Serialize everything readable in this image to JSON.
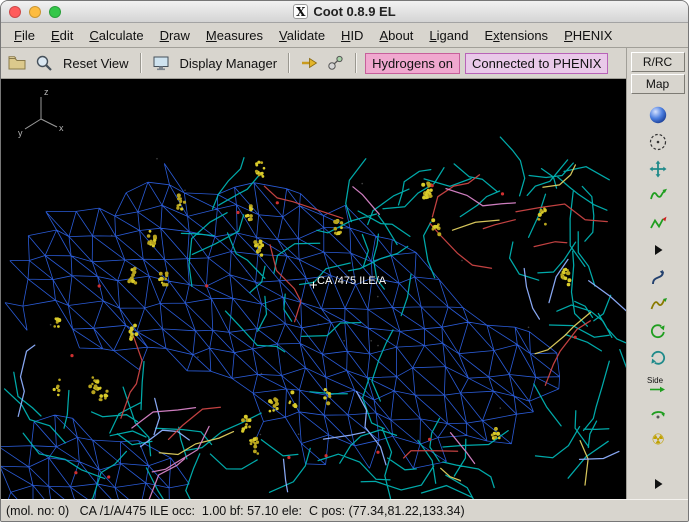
{
  "window": {
    "title": "Coot 0.8.9 EL",
    "logo_glyph": "X",
    "traffic_lights": [
      {
        "name": "close",
        "color": "#ff5c5c"
      },
      {
        "name": "minimize",
        "color": "#fdbc40"
      },
      {
        "name": "zoom",
        "color": "#34c749"
      }
    ]
  },
  "menu_bar": {
    "items": [
      {
        "label": "File",
        "u": 0
      },
      {
        "label": "Edit",
        "u": 0
      },
      {
        "label": "Calculate",
        "u": 0
      },
      {
        "label": "Draw",
        "u": 0
      },
      {
        "label": "Measures",
        "u": 0
      },
      {
        "label": "Validate",
        "u": 0
      },
      {
        "label": "HID",
        "u": 0
      },
      {
        "label": "About",
        "u": 0
      },
      {
        "label": "Ligand",
        "u": 0
      },
      {
        "label": "Extensions",
        "u": 1
      },
      {
        "label": "PHENIX",
        "u": 0
      }
    ]
  },
  "toolbar": {
    "icons": [
      {
        "name": "open-folder-icon",
        "kind": "folder"
      },
      {
        "name": "magnifier-icon",
        "kind": "magnifier"
      },
      {
        "name": "display-manager-icon",
        "kind": "monitor"
      },
      {
        "name": "go-to-atom-icon",
        "kind": "gotoarrow"
      },
      {
        "name": "atoms-icon",
        "kind": "atoms"
      }
    ],
    "reset_view_label": "Reset View",
    "display_manager_label": "Display Manager",
    "badges": [
      {
        "label": "Hydrogens on",
        "bg": "#f0a8cf",
        "border": "#c75f9b"
      },
      {
        "label": "Connected to PHENIX",
        "bg": "#e9c9e9",
        "border": "#b863b8"
      }
    ]
  },
  "right_panel": {
    "buttons": [
      {
        "label": "R/RC"
      },
      {
        "label": "Map"
      }
    ],
    "side_glyph_label": "Side",
    "icons": [
      {
        "name": "sphere-icon",
        "kind": "sphere"
      },
      {
        "name": "dashed-sphere-icon",
        "kind": "dashed"
      },
      {
        "name": "translate-view-icon",
        "kind": "movecross"
      },
      {
        "name": "refine-zone-icon",
        "kind": "spiral"
      },
      {
        "name": "regularize-zone-icon",
        "kind": "zigzag"
      },
      {
        "name": "expand-tools-icon",
        "kind": "tri"
      },
      {
        "name": "rotate-translate-icon",
        "kind": "chi"
      },
      {
        "name": "auto-fit-rotamer-icon",
        "kind": "squiggle"
      },
      {
        "name": "rotamers-icon",
        "kind": "rot1"
      },
      {
        "name": "edit-chi-angles-icon",
        "kind": "rot2"
      },
      {
        "name": "side-chain-flip-icon",
        "kind": "side"
      },
      {
        "name": "jed-flip-icon",
        "kind": "jed"
      },
      {
        "name": "radiation-icon",
        "kind": "radiation"
      },
      {
        "name": "more-tools-icon",
        "kind": "tri"
      }
    ]
  },
  "canvas": {
    "atom_label": "CA /475 ILE/A",
    "axes_labels": [
      "x",
      "y",
      "z"
    ],
    "scene": {
      "seed": 11,
      "bg": "#000000",
      "mesh_color": "#2e63e8",
      "stick_color": "#00b2b2",
      "stick_alt_colors": [
        "#8fb0ff",
        "#cc4444",
        "#d884c8",
        "#e0d060"
      ],
      "dot_color": "#d9cb2a",
      "dot_alt_color": "#b8a41e",
      "water_color": "#d03030",
      "axes_color": "#9a9a9a",
      "label_color": "#ffffff"
    }
  },
  "status_bar": {
    "text": "(mol. no: 0)   CA /1/A/475 ILE occ:  1.00 bf: 57.10 ele:  C pos: (77.34,81.22,133.34)"
  }
}
